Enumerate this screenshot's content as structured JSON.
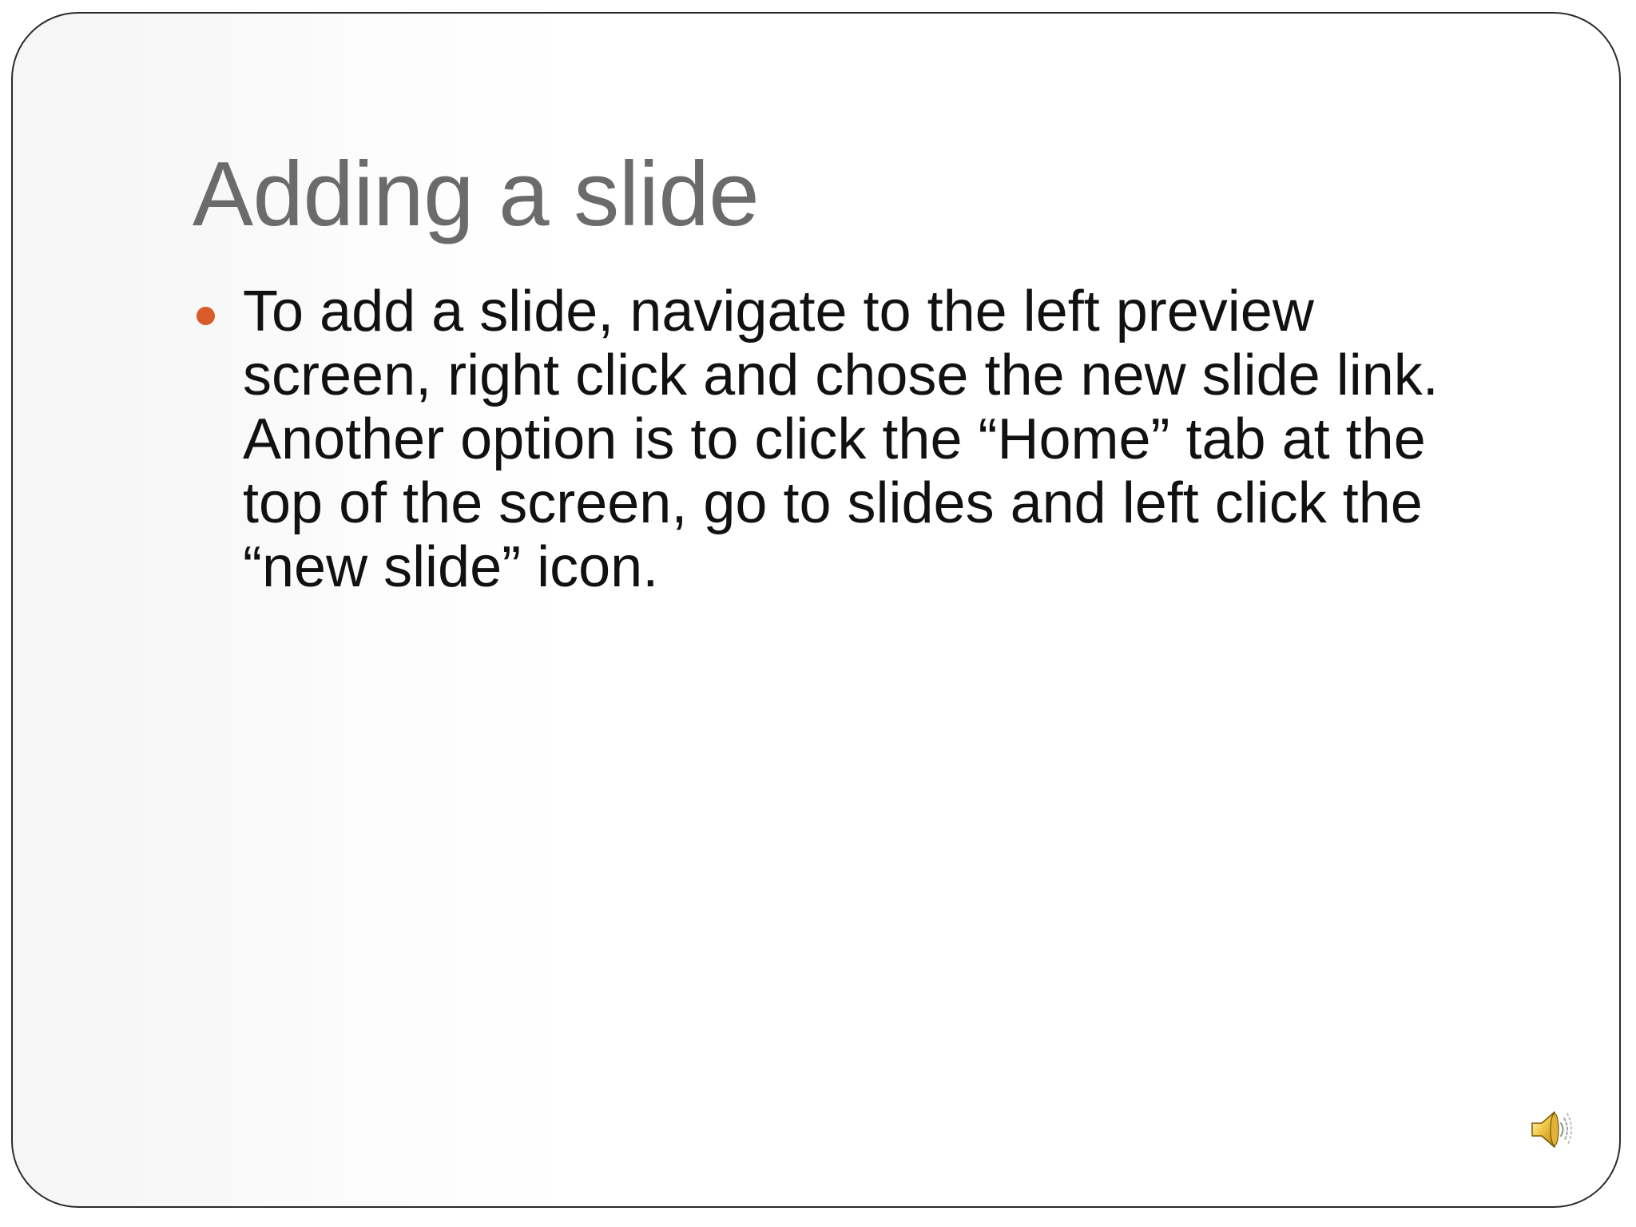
{
  "slide": {
    "title": "Adding a slide",
    "bullets": [
      {
        "text": "To add a slide, navigate to the left preview\nscreen, right click and chose the new slide link.\nAnother option is to click the “Home” tab at the\ntop of the screen, go to slides and left click the\n“new slide” icon."
      }
    ],
    "bullet_color": "#d95b27",
    "title_color": "#6b6b6b",
    "audio_icon": "speaker-icon"
  }
}
